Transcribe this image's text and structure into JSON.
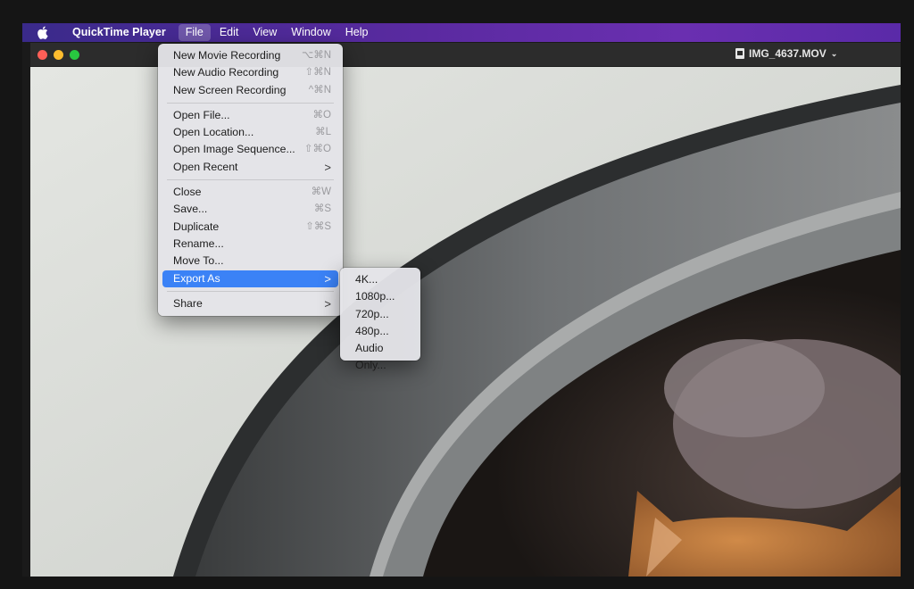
{
  "menubar": {
    "app_name": "QuickTime Player",
    "items": [
      "File",
      "Edit",
      "View",
      "Window",
      "Help"
    ]
  },
  "window": {
    "title": "IMG_4637.MOV"
  },
  "file_menu": {
    "group1": [
      {
        "label": "New Movie Recording",
        "shortcut": "⌥⌘N"
      },
      {
        "label": "New Audio Recording",
        "shortcut": "⇧⌘N"
      },
      {
        "label": "New Screen Recording",
        "shortcut": "^⌘N"
      }
    ],
    "group2": [
      {
        "label": "Open File...",
        "shortcut": "⌘O"
      },
      {
        "label": "Open Location...",
        "shortcut": "⌘L"
      },
      {
        "label": "Open Image Sequence...",
        "shortcut": "⇧⌘O"
      },
      {
        "label": "Open Recent",
        "shortcut": ">"
      }
    ],
    "group3": [
      {
        "label": "Close",
        "shortcut": "⌘W"
      },
      {
        "label": "Save...",
        "shortcut": "⌘S"
      },
      {
        "label": "Duplicate",
        "shortcut": "⇧⌘S"
      },
      {
        "label": "Rename..."
      },
      {
        "label": "Move To..."
      },
      {
        "label": "Export As",
        "shortcut": ">"
      }
    ],
    "group4": [
      {
        "label": "Share",
        "shortcut": ">"
      }
    ]
  },
  "export_submenu": {
    "items": [
      "4K...",
      "1080p...",
      "720p...",
      "480p...",
      "Audio Only..."
    ]
  },
  "colors": {
    "highlight": "#3b82f6",
    "menubar_start": "#3a2a8a",
    "menubar_end": "#6a2fb0"
  }
}
